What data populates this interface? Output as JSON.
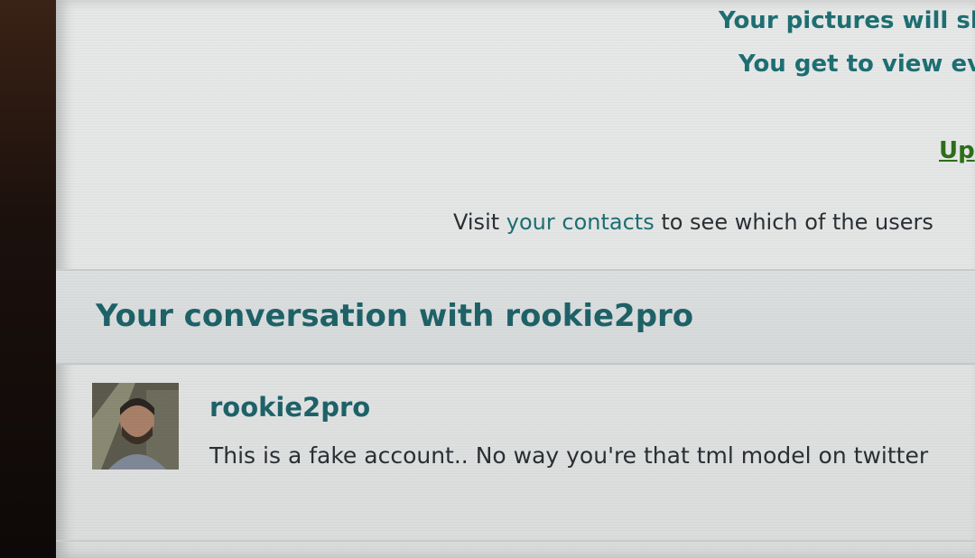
{
  "promo": {
    "line1": "Your pictures will sh",
    "line2": "You get to view ev",
    "upgrade_link": "Up"
  },
  "contacts_notice": {
    "prefix": "Visit ",
    "link": "your contacts",
    "suffix": " to see which of the users"
  },
  "conversation": {
    "title": "Your conversation with rookie2pro",
    "messages": [
      {
        "sender": "rookie2pro",
        "text": "This is a fake account.. No way you're that tml model on twitter"
      }
    ]
  },
  "colors": {
    "heading_teal": "#1e6268",
    "link_teal": "#1e6f72",
    "upgrade_green": "#2d6e1a",
    "body_text": "#2a2f33"
  }
}
